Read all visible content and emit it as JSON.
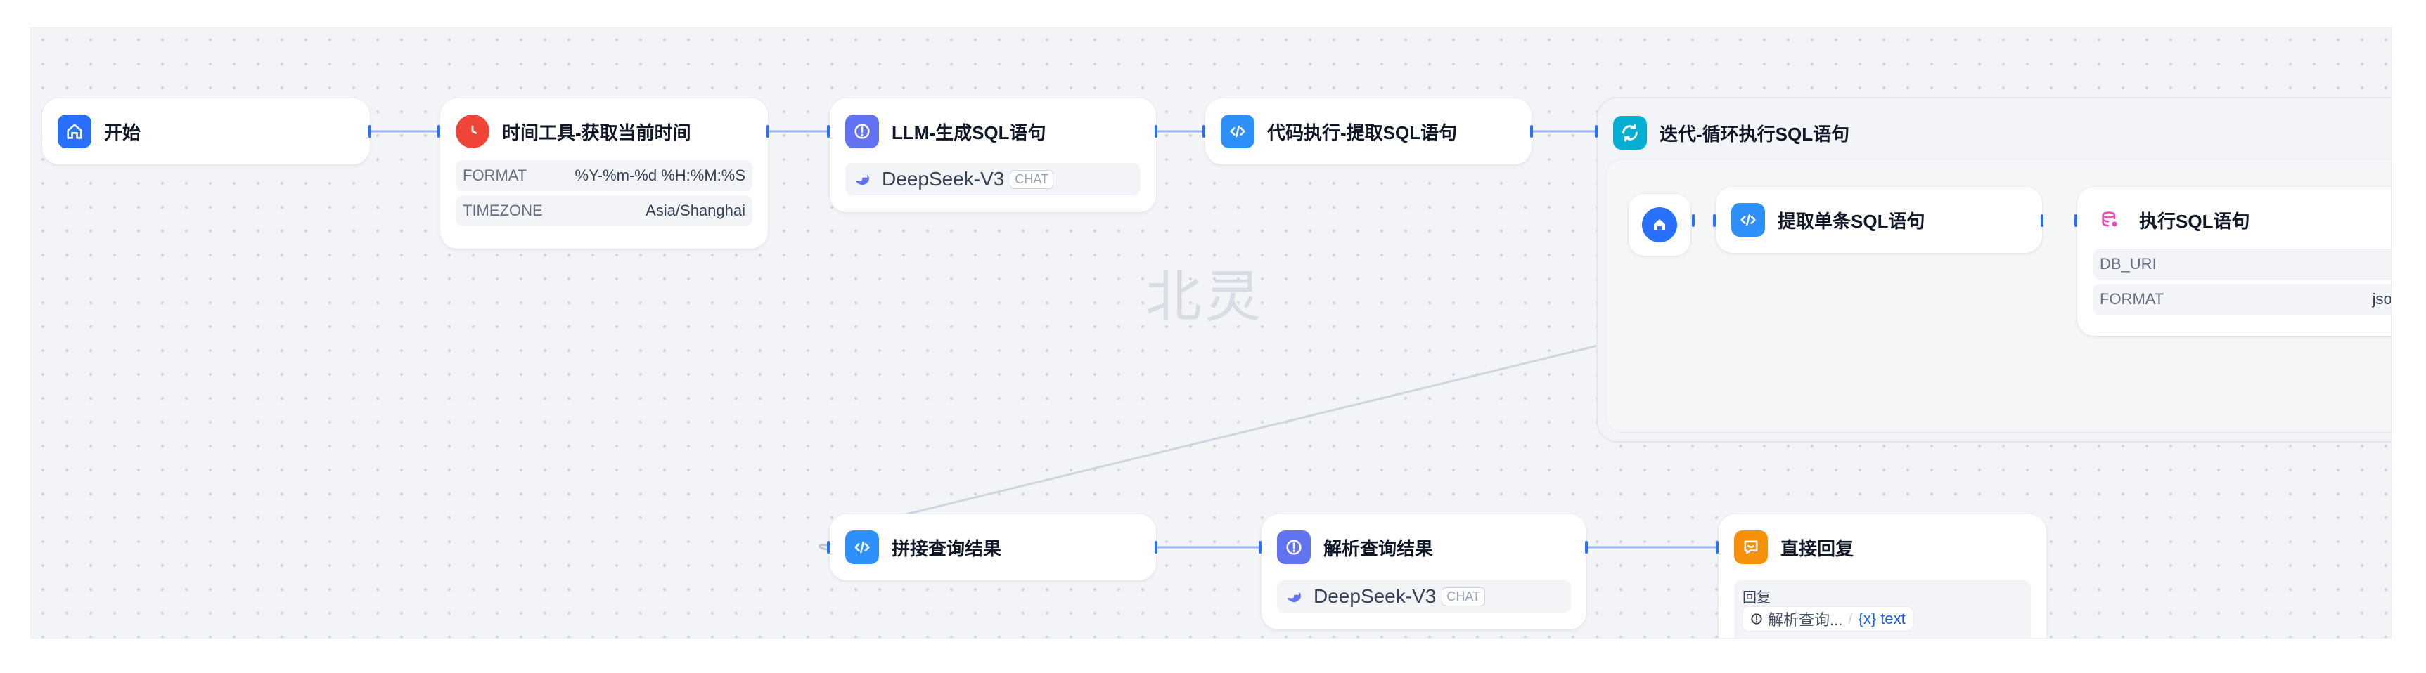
{
  "watermark": "北灵",
  "nodes": {
    "start": {
      "title": "开始",
      "icon": "home-icon",
      "color": "#2970ff"
    },
    "time_tool": {
      "title": "时间工具-获取当前时间",
      "icon": "clock-icon",
      "color": "#f04438",
      "params": [
        {
          "key": "FORMAT",
          "value": "%Y-%m-%d %H:%M:%S"
        },
        {
          "key": "TIMEZONE",
          "value": "Asia/Shanghai"
        }
      ]
    },
    "llm_gen": {
      "title": "LLM-生成SQL语句",
      "icon": "llm-icon",
      "color": "#6172f3",
      "model": "DeepSeek-V3",
      "badge": "CHAT"
    },
    "code_extract": {
      "title": "代码执行-提取SQL语句",
      "icon": "code-icon",
      "color": "#2e90fa"
    },
    "iteration": {
      "title": "迭代-循环执行SQL语句",
      "icon": "loop-icon",
      "color": "#06aed4"
    },
    "extract_single": {
      "title": "提取单条SQL语句",
      "icon": "code-icon",
      "color": "#2e90fa"
    },
    "exec_sql": {
      "title": "执行SQL语句",
      "icon": "database-icon",
      "color": "#ee46bc",
      "params": [
        {
          "key": "DB_URI",
          "value": ""
        },
        {
          "key": "FORMAT",
          "value": "json"
        }
      ]
    },
    "concat": {
      "title": "拼接查询结果",
      "icon": "code-icon",
      "color": "#2e90fa"
    },
    "parse": {
      "title": "解析查询结果",
      "icon": "llm-icon",
      "color": "#6172f3",
      "model": "DeepSeek-V3",
      "badge": "CHAT"
    },
    "reply": {
      "title": "直接回复",
      "icon": "reply-icon",
      "color": "#f79009",
      "label": "回复",
      "ref_node": "解析查询...",
      "ref_sep": "/",
      "ref_var": "{x} text"
    }
  }
}
